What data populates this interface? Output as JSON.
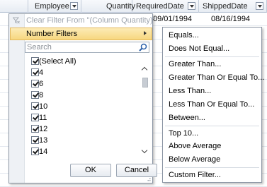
{
  "grid": {
    "columns": [
      {
        "label": "Employee"
      },
      {
        "label": "Quantity"
      },
      {
        "label": "RequiredDate"
      },
      {
        "label": "ShippedDate"
      }
    ],
    "visible_row": {
      "required_date": "09/01/1994",
      "shipped_date": "08/16/1994"
    }
  },
  "filter_popup": {
    "clear_filter_label": "Clear Filter From \"(Column Quantity)\"",
    "number_filters_label": "Number Filters",
    "search_placeholder": "Search",
    "items": [
      {
        "label": "(Select All)",
        "checked": true
      },
      {
        "label": "4",
        "checked": true
      },
      {
        "label": "6",
        "checked": true
      },
      {
        "label": "8",
        "checked": true
      },
      {
        "label": "10",
        "checked": true
      },
      {
        "label": "11",
        "checked": true
      },
      {
        "label": "12",
        "checked": true
      },
      {
        "label": "13",
        "checked": true
      },
      {
        "label": "14",
        "checked": true
      }
    ],
    "ok_label": "OK",
    "cancel_label": "Cancel"
  },
  "number_filters_menu": {
    "items": [
      {
        "label": "Equals..."
      },
      {
        "label": "Does Not Equal..."
      },
      {
        "label": "Greater Than..."
      },
      {
        "label": "Greater Than Or Equal To..."
      },
      {
        "label": "Less Than..."
      },
      {
        "label": "Less Than Or Equal To..."
      },
      {
        "label": "Between..."
      },
      {
        "label": "Top 10..."
      },
      {
        "label": "Above Average"
      },
      {
        "label": "Below Average"
      },
      {
        "label": "Custom Filter..."
      }
    ]
  },
  "colors": {
    "highlight": "#f7d77f",
    "border": "#8c96a4",
    "disabled_text": "#9da4ae"
  }
}
